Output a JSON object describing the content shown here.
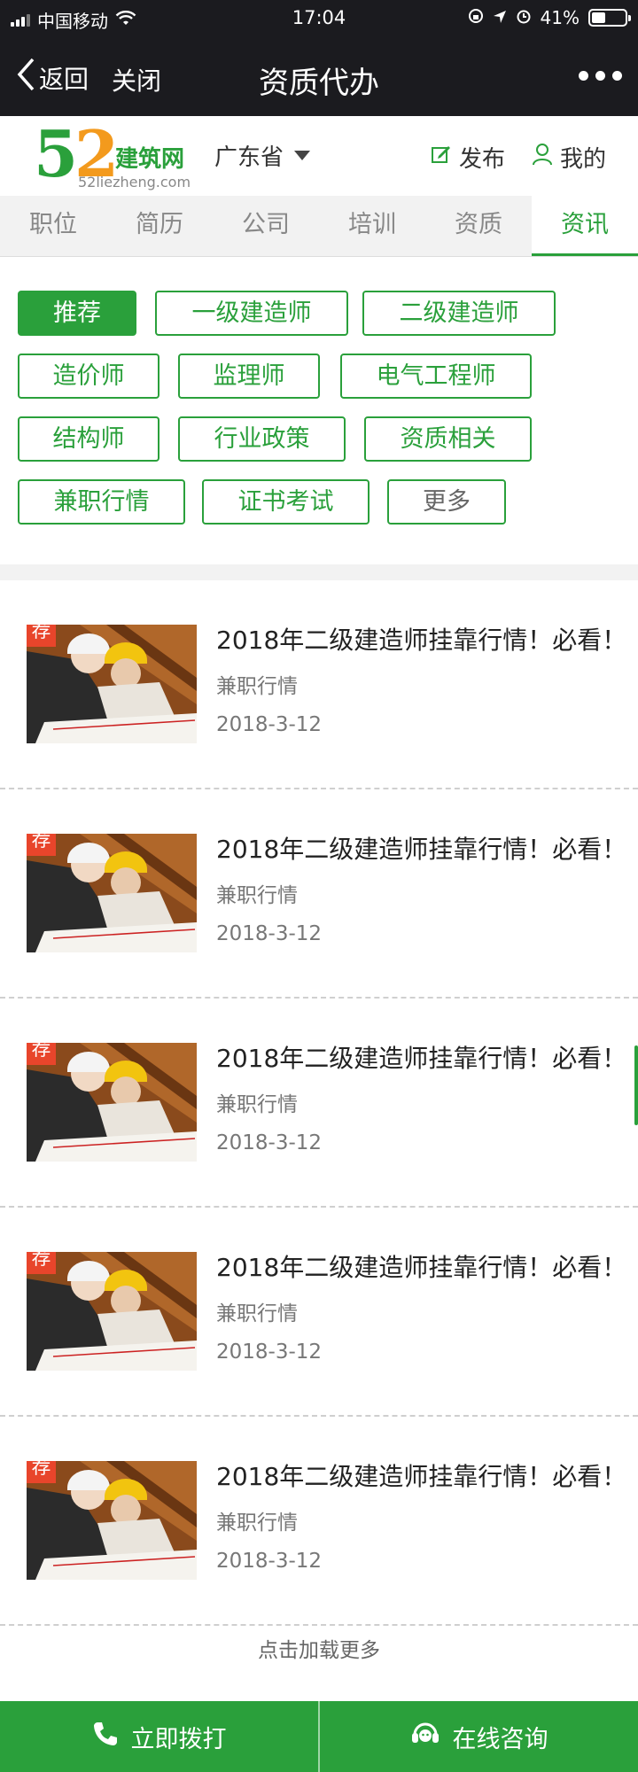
{
  "status": {
    "carrier": "中国移动",
    "time": "17:04",
    "battery": "41%",
    "battery_level": 0.41
  },
  "nav": {
    "back_label": "返回",
    "close_label": "关闭",
    "title": "资质代办"
  },
  "header": {
    "logo_5": "5",
    "logo_2": "2",
    "logo_brand": "建筑网",
    "logo_domain": "52liezheng.com",
    "region": "广东省",
    "publish_label": "发布",
    "mine_label": "我的"
  },
  "tabs": [
    {
      "label": "职位"
    },
    {
      "label": "简历"
    },
    {
      "label": "公司"
    },
    {
      "label": "培训"
    },
    {
      "label": "资质"
    },
    {
      "label": "资讯",
      "active": true
    }
  ],
  "tags": [
    {
      "label": "推荐",
      "active": true
    },
    {
      "label": "一级建造师"
    },
    {
      "label": "二级建造师"
    },
    {
      "label": "造价师"
    },
    {
      "label": "监理师"
    },
    {
      "label": "电气工程师"
    },
    {
      "label": "结构师"
    },
    {
      "label": "行业政策"
    },
    {
      "label": "资质相关"
    },
    {
      "label": "兼职行情"
    },
    {
      "label": "证书考试"
    },
    {
      "label": "更多"
    }
  ],
  "articles": [
    {
      "badge": "荐",
      "title": "2018年二级建造师挂靠行情！必看！",
      "category": "兼职行情",
      "date": "2018-3-12"
    },
    {
      "badge": "荐",
      "title": "2018年二级建造师挂靠行情！必看！",
      "category": "兼职行情",
      "date": "2018-3-12"
    },
    {
      "badge": "荐",
      "title": "2018年二级建造师挂靠行情！必看！",
      "category": "兼职行情",
      "date": "2018-3-12"
    },
    {
      "badge": "荐",
      "title": "2018年二级建造师挂靠行情！必看！",
      "category": "兼职行情",
      "date": "2018-3-12"
    },
    {
      "badge": "荐",
      "title": "2018年二级建造师挂靠行情！必看！",
      "category": "兼职行情",
      "date": "2018-3-12"
    }
  ],
  "load_more": "点击加载更多",
  "bottom": {
    "call_label": "立即拨打",
    "consult_label": "在线咨询"
  },
  "colors": {
    "accent": "#2aa03b",
    "badge": "#e8452b",
    "topbar": "#1b1b1f"
  }
}
